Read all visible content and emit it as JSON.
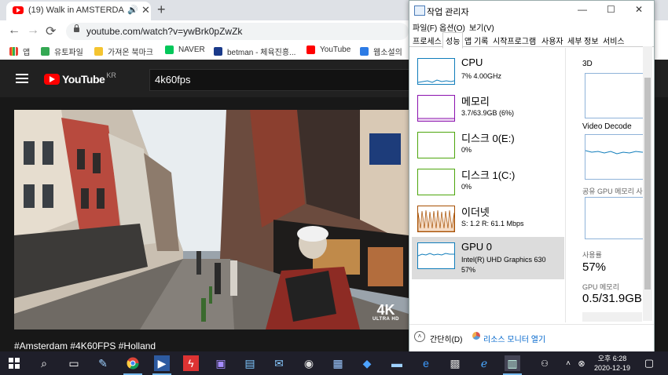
{
  "browser": {
    "tab_title": "(19) Walk in AMSTERDAM, Ne...",
    "tab_audio": "🔊",
    "tab_close": "✕",
    "new_tab": "+",
    "url": "youtube.com/watch?v=ywBrk0pZwZk",
    "back": "←",
    "forward": "→",
    "reload": "⟳",
    "bookmarks": [
      {
        "label": "앱",
        "color": "#ea4335"
      },
      {
        "label": "유토파일",
        "color": "#34a853"
      },
      {
        "label": "가져온 북마크",
        "color": "#f4c430"
      },
      {
        "label": "NAVER",
        "color": "#03c75a"
      },
      {
        "label": "betman - 체육진흥...",
        "color": "#1a3a8a"
      },
      {
        "label": "YouTube",
        "color": "#ff0000"
      },
      {
        "label": "웹소설의",
        "color": "#2c7be5"
      }
    ]
  },
  "youtube": {
    "logo_text": "YouTube",
    "region": "KR",
    "search_value": "4k60fps",
    "video_badge_big": "4K",
    "video_badge_small": "ULTRA HD",
    "hashtags": "#Amsterdam #4K60FPS #Holland"
  },
  "task_manager": {
    "title": "작업 관리자",
    "controls": {
      "minimize": "—",
      "maximize": "☐",
      "close": "✕"
    },
    "menu": [
      "파일(F)",
      "옵션(O)",
      "보기(V)"
    ],
    "tabs": [
      "프로세스",
      "성능",
      "앱 기록",
      "시작프로그램",
      "사용자",
      "세부 정보",
      "서비스"
    ],
    "active_tab": "성능",
    "items": [
      {
        "name": "CPU",
        "line1": "7% 4.00GHz",
        "line2": "",
        "color": "#117dbb"
      },
      {
        "name": "메모리",
        "line1": "3.7/63.9GB (6%)",
        "line2": "",
        "color": "#8b12ae"
      },
      {
        "name": "디스크 0(E:)",
        "line1": "0%",
        "line2": "",
        "color": "#4da60c"
      },
      {
        "name": "디스크 1(C:)",
        "line1": "0%",
        "line2": "",
        "color": "#4da60c"
      },
      {
        "name": "이더넷",
        "line1": "S: 1.2  R: 61.1 Mbps",
        "line2": "",
        "color": "#a74f01"
      },
      {
        "name": "GPU 0",
        "line1": "Intel(R) UHD Graphics 630",
        "line2": "57%",
        "color": "#117dbb"
      }
    ],
    "selected_item": "GPU 0",
    "right_panel": {
      "engine1": "3D",
      "engine2": "Video Decode",
      "shared_mem_label": "공유 GPU 메모리 사",
      "usage_label": "사용률",
      "usage_value": "57%",
      "gpu_mem_label": "GPU 메모리",
      "gpu_mem_value": "0.5/31.9GB"
    },
    "footer": {
      "collapse": "간단히(D)",
      "resource_monitor": "리소스 모니터 열기"
    }
  },
  "taskbar": {
    "time": "오후 6:28",
    "date": "2020-12-19",
    "icons": [
      "windows-icon",
      "search-icon",
      "task-view-icon",
      "paint-icon",
      "chrome-icon",
      "media-player-icon",
      "flash-icon",
      "chip-icon",
      "notes-icon",
      "mail-icon",
      "network-icon",
      "monitor-icon",
      "dropbox-icon",
      "screen-icon",
      "edge-icon",
      "calculator-icon",
      "ie-icon",
      "task-manager-icon"
    ]
  }
}
